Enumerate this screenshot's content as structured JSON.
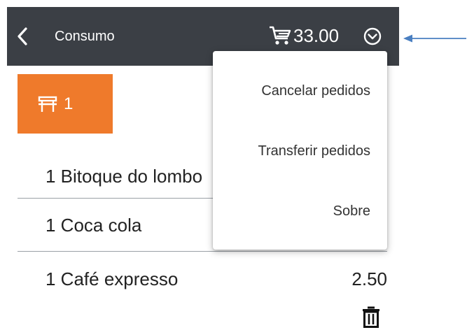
{
  "header": {
    "title": "Consumo",
    "cart_total": "33.00",
    "back_icon": "chevron-left-icon",
    "cart_icon": "cart-icon",
    "menu_icon": "chevron-down-circle-icon",
    "background": "#3b3f45"
  },
  "table": {
    "number": "1",
    "icon": "table-icon",
    "color": "#ef7a2b"
  },
  "items": [
    {
      "name": "1 Bitoque do lombo",
      "price": ""
    },
    {
      "name": "1 Coca cola",
      "price": ""
    },
    {
      "name": "1 Café expresso",
      "price": "2.50"
    }
  ],
  "dropdown": {
    "items": [
      "Cancelar pedidos",
      "Transferir pedidos",
      "Sobre"
    ]
  },
  "annotation": {
    "arrow_color": "#4a7fc1"
  }
}
